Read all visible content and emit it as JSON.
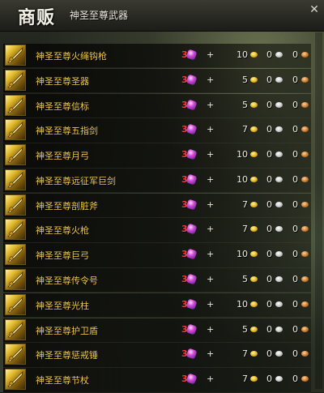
{
  "window": {
    "title": "商贩",
    "subtitle": "神圣至尊武器",
    "close_icon": "close-icon"
  },
  "columns": {
    "gem_icon": "purple-gem-icon",
    "gold_icon": "gold-coin-icon",
    "silver_icon": "silver-coin-icon",
    "copper_icon": "copper-coin-icon"
  },
  "items": [
    {
      "name": "神圣至尊火绳钩枪",
      "icon": "gun-icon",
      "gems": "3",
      "plus": "+",
      "gold": "10",
      "silver": "0",
      "copper": "0"
    },
    {
      "name": "神圣至尊圣器",
      "icon": "relic-icon",
      "gems": "3",
      "plus": "+",
      "gold": "5",
      "silver": "0",
      "copper": "0"
    },
    {
      "name": "神圣至尊信标",
      "icon": "beacon-icon",
      "gems": "3",
      "plus": "+",
      "gold": "5",
      "silver": "0",
      "copper": "0"
    },
    {
      "name": "神圣至尊五指剑",
      "icon": "sword-icon",
      "gems": "3",
      "plus": "+",
      "gold": "7",
      "silver": "0",
      "copper": "0"
    },
    {
      "name": "神圣至尊月弓",
      "icon": "bow-icon",
      "gems": "3",
      "plus": "+",
      "gold": "10",
      "silver": "0",
      "copper": "0"
    },
    {
      "name": "神圣至尊远征军巨剑",
      "icon": "greatsword-icon",
      "gems": "3",
      "plus": "+",
      "gold": "10",
      "silver": "0",
      "copper": "0"
    },
    {
      "name": "神圣至尊剖脏斧",
      "icon": "axe-icon",
      "gems": "3",
      "plus": "+",
      "gold": "7",
      "silver": "0",
      "copper": "0"
    },
    {
      "name": "神圣至尊火枪",
      "icon": "pistol-icon",
      "gems": "3",
      "plus": "+",
      "gold": "7",
      "silver": "0",
      "copper": "0"
    },
    {
      "name": "神圣至尊巨弓",
      "icon": "longbow-icon",
      "gems": "3",
      "plus": "+",
      "gold": "10",
      "silver": "0",
      "copper": "0"
    },
    {
      "name": "神圣至尊传令号",
      "icon": "horn-icon",
      "gems": "3",
      "plus": "+",
      "gold": "5",
      "silver": "0",
      "copper": "0"
    },
    {
      "name": "神圣至尊光柱",
      "icon": "staff-icon",
      "gems": "3",
      "plus": "+",
      "gold": "10",
      "silver": "0",
      "copper": "0"
    },
    {
      "name": "神圣至尊护卫盾",
      "icon": "shield-icon",
      "gems": "3",
      "plus": "+",
      "gold": "5",
      "silver": "0",
      "copper": "0"
    },
    {
      "name": "神圣至尊惩戒锤",
      "icon": "hammer-icon",
      "gems": "3",
      "plus": "+",
      "gold": "7",
      "silver": "0",
      "copper": "0"
    },
    {
      "name": "神圣至尊节杖",
      "icon": "scepter-icon",
      "gems": "3",
      "plus": "+",
      "gold": "7",
      "silver": "0",
      "copper": "0"
    }
  ]
}
